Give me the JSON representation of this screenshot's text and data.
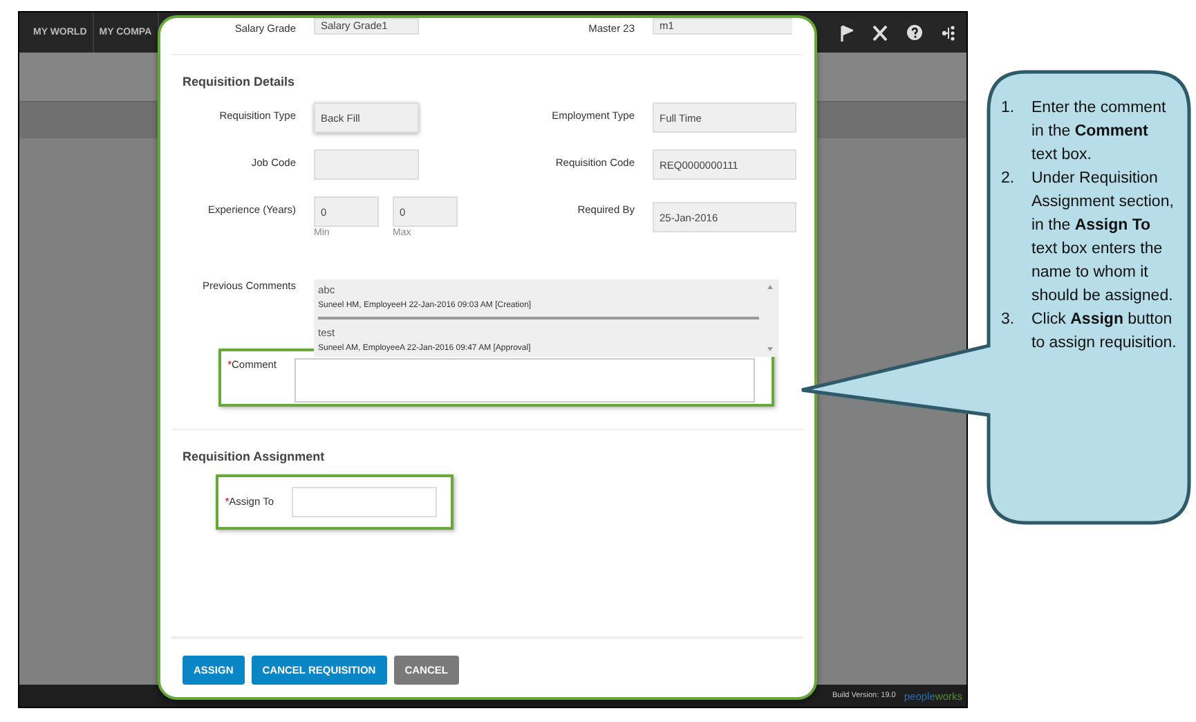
{
  "nav": {
    "items": [
      "MY WORLD",
      "MY COMPA"
    ]
  },
  "top_row": {
    "left_label": "Salary Grade",
    "left_value": "Salary Grade1",
    "right_label": "Master 23",
    "right_value": "m1"
  },
  "details": {
    "title": "Requisition Details",
    "rows": [
      {
        "left": {
          "kind": "single",
          "label": "Requisition Type",
          "values": [
            "Back Fill"
          ]
        },
        "right": {
          "label": "Employment Type",
          "value": "Full Time"
        }
      },
      {
        "left": {
          "kind": "blank",
          "label": "Job Code"
        },
        "right": {
          "label": "Requisition Code",
          "value": "REQ0000000111"
        }
      },
      {
        "left": {
          "kind": "range",
          "label": "Experience (Years)",
          "values": [
            "0",
            "0"
          ],
          "hints": [
            "Min",
            "Max"
          ]
        },
        "right": {
          "label": "Required By",
          "value": "25-Jan-2016"
        }
      }
    ]
  },
  "previous_comments": {
    "label": "Previous Comments",
    "items": [
      {
        "text": "abc",
        "meta": "Suneel HM,  EmployeeH  22-Jan-2016 09:03 AM [Creation]"
      },
      {
        "text": "test",
        "meta": "Suneel AM,  EmployeeA  22-Jan-2016 09:47 AM [Approval]"
      }
    ]
  },
  "comment": {
    "label": "Comment",
    "required": true,
    "required_mark": "*"
  },
  "assignment": {
    "title": "Requisition Assignment",
    "label": "Assign To",
    "required": true,
    "required_mark": "*"
  },
  "buttons": [
    {
      "label": "ASSIGN",
      "kind": "primary"
    },
    {
      "label": "CANCEL REQUISITION",
      "kind": "primary"
    },
    {
      "label": "CANCEL",
      "kind": "secondary"
    }
  ],
  "footer": {
    "build": "Build Version: 19.0",
    "logo_parts": [
      "people",
      "works"
    ]
  },
  "callout": {
    "steps": [
      {
        "number": "1.",
        "text": "Enter the comment in the **Comment** text box."
      },
      {
        "number": "2.",
        "text": "Under Requisition Assignment section, in the **Assign To** text box enters the name to whom it should be assigned."
      },
      {
        "number": "3.",
        "text": "Click **Assign** button to assign requisition."
      }
    ]
  }
}
